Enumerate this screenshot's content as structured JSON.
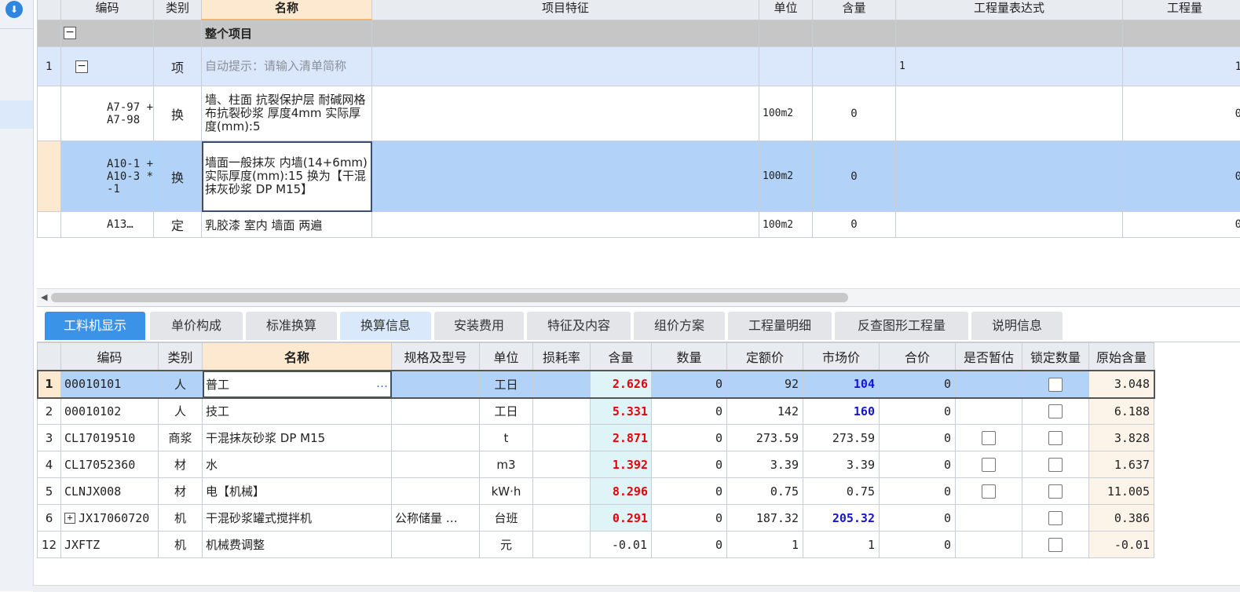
{
  "top_table": {
    "headers": [
      "编码",
      "类别",
      "名称",
      "项目特征",
      "单位",
      "含量",
      "工程量表达式",
      "工程量"
    ],
    "whole_project": "整个项目",
    "tree_toggle": "−",
    "rows": [
      {
        "idx": "1",
        "code": "",
        "type": "项",
        "name": "自动提示：请输入清单简称",
        "unit": "",
        "content": "",
        "expr": "1",
        "qty": "1"
      },
      {
        "idx": "",
        "code": "A7-97 + A7-98",
        "type": "换",
        "name": "墙、柱面 抗裂保护层 耐碱网格布抗裂砂浆 厚度4mm  实际厚度(mm):5",
        "unit": "100m2",
        "content": "0",
        "expr": "",
        "qty": "0"
      },
      {
        "idx": "",
        "code": "A10-1 + A10-3 * -1",
        "type": "换",
        "name": "墙面一般抹灰 内墙(14+6mm)  实际厚度(mm):15  换为【干混抹灰砂浆 DP M15】",
        "unit": "100m2",
        "content": "0",
        "expr": "",
        "qty": "0"
      },
      {
        "idx": "",
        "code": "A13…",
        "type": "定",
        "name": "乳胶漆 室内 墙面 两遍",
        "unit": "100m2",
        "content": "0",
        "expr": "",
        "qty": "0"
      }
    ]
  },
  "tabs": [
    "工料机显示",
    "单价构成",
    "标准换算",
    "换算信息",
    "安装费用",
    "特征及内容",
    "组价方案",
    "工程量明细",
    "反查图形工程量",
    "说明信息"
  ],
  "bottom_table": {
    "headers": [
      "编码",
      "类别",
      "名称",
      "规格及型号",
      "单位",
      "损耗率",
      "含量",
      "数量",
      "定额价",
      "市场价",
      "合价",
      "是否暂估",
      "锁定数量",
      "原始含量"
    ],
    "rows": [
      {
        "idx": "1",
        "code": "00010101",
        "type": "人",
        "name": "普工",
        "spec": "",
        "unit": "工日",
        "loss": "",
        "content": "2.626",
        "amount": "0",
        "quota": "92",
        "market": "104",
        "total": "0",
        "orig": "3.048"
      },
      {
        "idx": "2",
        "code": "00010102",
        "type": "人",
        "name": "技工",
        "spec": "",
        "unit": "工日",
        "loss": "",
        "content": "5.331",
        "amount": "0",
        "quota": "142",
        "market": "160",
        "total": "0",
        "orig": "6.188"
      },
      {
        "idx": "3",
        "code": "CL17019510",
        "type": "商浆",
        "name": "干混抹灰砂浆 DP M15",
        "spec": "",
        "unit": "t",
        "loss": "",
        "content": "2.871",
        "amount": "0",
        "quota": "273.59",
        "market": "273.59",
        "total": "0",
        "orig": "3.828"
      },
      {
        "idx": "4",
        "code": "CL17052360",
        "type": "材",
        "name": "水",
        "spec": "",
        "unit": "m3",
        "loss": "",
        "content": "1.392",
        "amount": "0",
        "quota": "3.39",
        "market": "3.39",
        "total": "0",
        "orig": "1.637"
      },
      {
        "idx": "5",
        "code": "CLNJX008",
        "type": "材",
        "name": "电【机械】",
        "spec": "",
        "unit": "kW·h",
        "loss": "",
        "content": "8.296",
        "amount": "0",
        "quota": "0.75",
        "market": "0.75",
        "total": "0",
        "orig": "11.005"
      },
      {
        "idx": "6",
        "code": "JX17060720",
        "type": "机",
        "name": "干混砂浆罐式搅拌机",
        "spec": "公称储量 …",
        "unit": "台班",
        "loss": "",
        "content": "0.291",
        "amount": "0",
        "quota": "187.32",
        "market": "205.32",
        "total": "0",
        "orig": "0.386"
      },
      {
        "idx": "12",
        "code": "JXFTZ",
        "type": "机",
        "name": "机械费调整",
        "spec": "",
        "unit": "元",
        "loss": "",
        "content": "-0.01",
        "amount": "0",
        "quota": "1",
        "market": "1",
        "total": "0",
        "orig": "-0.01"
      }
    ],
    "ellipsis": "…",
    "plus": "+"
  },
  "colors": {
    "active_tab": "#3b93e8",
    "selected_row": "#b3d2f7",
    "red_value": "#e8000b",
    "blue_value": "#1515d6"
  },
  "icons": {
    "left_strip": "download-circle-icon"
  }
}
